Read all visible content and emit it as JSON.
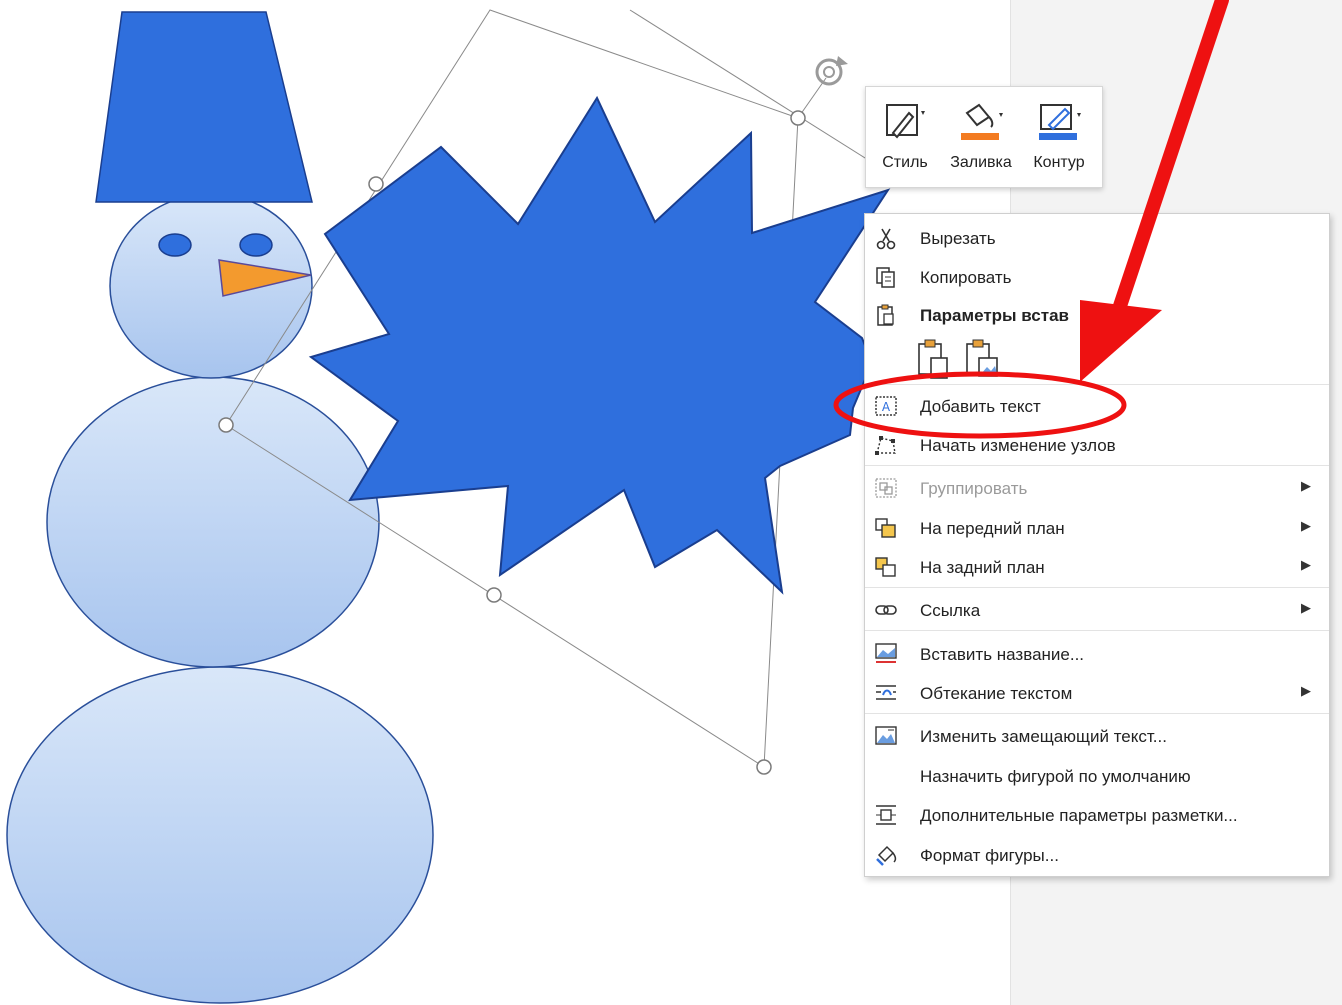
{
  "colors": {
    "shape_blue": "#2f6fdd",
    "shape_outline": "#1a3e8f",
    "snow_light": "#d6e4f8",
    "snow_mid": "#a9c6ef",
    "nose_orange": "#f39a2e",
    "fill_swatch": "#f37b21",
    "outline_swatch": "#2f6fdd",
    "annotation_red": "#ee1111",
    "disabled_text": "#9a9a9a"
  },
  "mini_toolbar": {
    "style_label": "Стиль",
    "fill_label": "Заливка",
    "outline_label": "Контур",
    "icons": [
      "style-brush-icon",
      "paint-bucket-icon",
      "pen-outline-icon"
    ]
  },
  "context_menu": {
    "cut": "Вырезать",
    "copy": "Копировать",
    "paste_options": "Параметры встав",
    "add_text": "Добавить текст",
    "edit_points": "Начать изменение узлов",
    "group": "Группировать",
    "bring_forward": "На передний план",
    "send_backward": "На задний план",
    "link": "Ссылка",
    "insert_caption": "Вставить название...",
    "wrap_text": "Обтекание текстом",
    "edit_alt_text": "Изменить замещающий текст...",
    "set_default_shape": "Назначить фигурой по умолчанию",
    "more_layout": "Дополнительные параметры разметки...",
    "format_shape": "Формат фигуры...",
    "submenu_arrow": "▶"
  }
}
